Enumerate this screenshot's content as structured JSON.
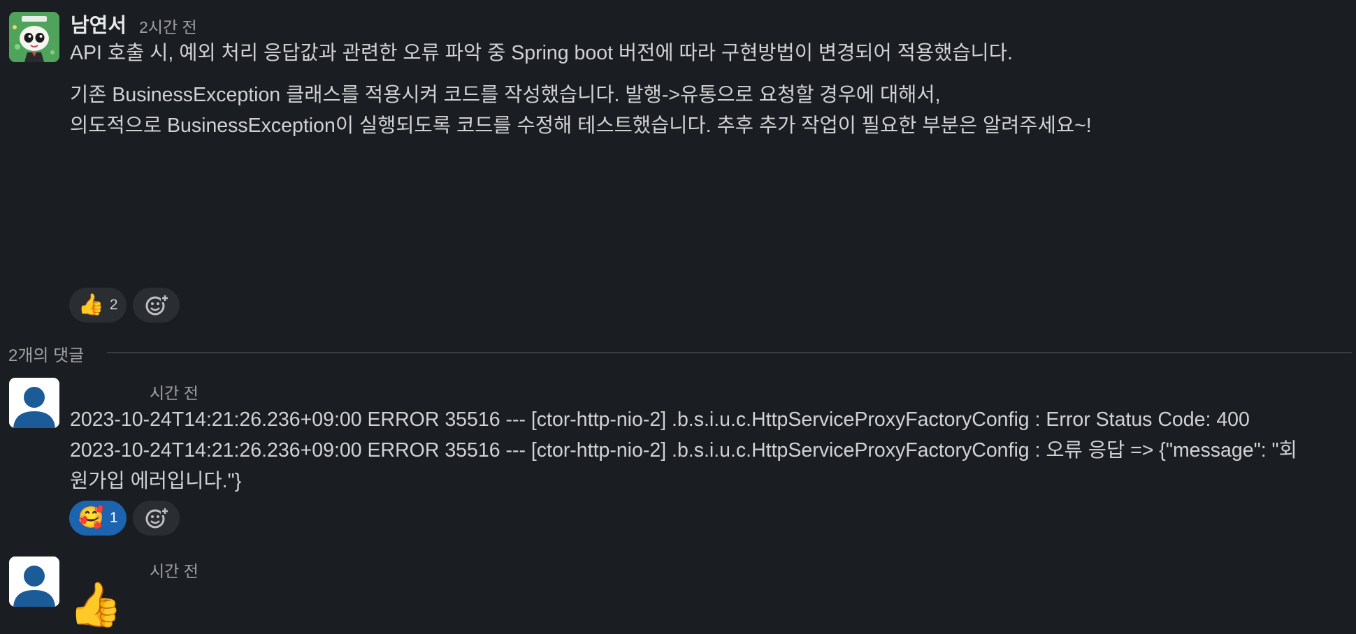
{
  "main_message": {
    "author": "남연서",
    "time": "2시간 전",
    "line1": "API 호출 시, 예외 처리 응답값과 관련한 오류 파악 중 Spring boot 버전에 따라 구현방법이 변경되어 적용했습니다.",
    "line2": "기존 BusinessException 클래스를 적용시켜 코드를 작성했습니다. 발행->유통으로 요청할 경우에 대해서,",
    "line3": "의도적으로 BusinessException이 실행되도록 코드를 수정해 테스트했습니다. 추후 추가 작업이 필요한 부분은 알려주세요~!",
    "reactions": [
      {
        "emoji": "thumbs-up",
        "count": "2"
      }
    ]
  },
  "thread": {
    "divider_label": "2개의 댓글",
    "replies": [
      {
        "time": "시간 전",
        "line1": "2023-10-24T14:21:26.236+09:00 ERROR 35516 --- [ctor-http-nio-2] .b.s.i.u.c.HttpServiceProxyFactoryConfig : Error Status Code: 400",
        "line2": "2023-10-24T14:21:26.236+09:00 ERROR 35516 --- [ctor-http-nio-2] .b.s.i.u.c.HttpServiceProxyFactoryConfig : 오류 응답 => {\"message\": \"회",
        "line3": "원가입 에러입니다.\"}",
        "reactions": [
          {
            "emoji": "smiling-face-with-hearts",
            "count": "1"
          }
        ]
      },
      {
        "time": "시간 전",
        "emoji": "thumbs-up"
      }
    ]
  },
  "colors": {
    "background": "#1a1d21",
    "text": "#d1d2d3",
    "muted": "#a0a1a3",
    "active_reaction": "#1d64b0",
    "reaction_bg": "#2a2d31"
  }
}
